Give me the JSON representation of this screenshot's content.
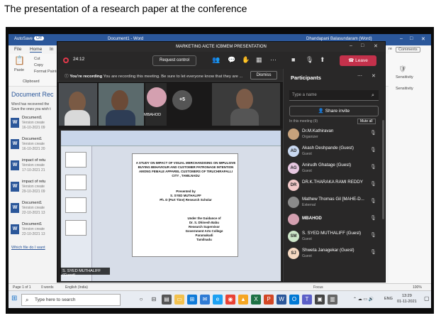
{
  "caption": "The presentation of a research paper at the conference",
  "word": {
    "autosave": "AutoSave",
    "autosave_state": "Off",
    "doc_title": "Document1 - Word",
    "user": "Dhandapani Balasundaram (Word)",
    "tabs": [
      "File",
      "Home",
      "In"
    ],
    "ribbon": {
      "paste": "Paste",
      "cut": "Cut",
      "copy": "Copy",
      "format_painter": "Format Painter",
      "clipboard": "Clipboard",
      "sensitivity": "Sensitivity",
      "comments": "Comments",
      "right_tab": "re"
    },
    "recovery": {
      "heading": "Document Rec",
      "line1": "Word has recovered the",
      "line2": "Save the ones you wish t",
      "items": [
        {
          "name": "Document1",
          "sub1": "Version create",
          "sub2": "16-10-2021 09"
        },
        {
          "name": "Document1",
          "sub1": "Version create",
          "sub2": "16-10-2021 20"
        },
        {
          "name": "impact of retu",
          "sub1": "Version create",
          "sub2": "17-10-2021 21"
        },
        {
          "name": "impact of retu",
          "sub1": "Version create",
          "sub2": "29-10-2021 09"
        },
        {
          "name": "Document1",
          "sub1": "Version create",
          "sub2": "22-10-2021 13"
        },
        {
          "name": "Document1",
          "sub1": "Version create",
          "sub2": "22-10-2021 13"
        }
      ],
      "link": "Which file do I want"
    },
    "status": {
      "page": "Page 1 of 1",
      "words": "0 words",
      "language": "English (India)",
      "focus": "Focus",
      "zoom": "100%"
    }
  },
  "teams": {
    "title": "MARKETING AICTE ICBMEM PRESENTATION",
    "timer": "24:12",
    "request_control": "Request control",
    "leave": "Leave",
    "banner_bold": "You're recording",
    "banner_text": "You are recording this meeting. Be sure to let everyone know that they are ...",
    "dismiss": "Dismiss",
    "tile_label": "MBAHOD",
    "more_count": "+5",
    "presenter_label": "S. SYED MUTHALIFF (Guest)",
    "slide": {
      "title": "A STUDY ON IMPACT OF VISUAL MERCHANDISING ON IMPULSIVE BUYING BEHAVIOUR AND CUSTOMER PATRONAGE INTENTION AMONG FEMALE APPAREL CUSTOMERS OF TIRUCHIRAPALLI CITY , TAMILNADU",
      "presented_by": "Presented by",
      "presenter": "S. SYED MUTHALIFF",
      "presenter_role": "Ph. D (Part Time) Research Scholar",
      "guidance": "Under the Guidance of",
      "guide": "Dr. S. Dhinesh Babu",
      "guide_role": "Research Supervisor",
      "college": "Government Arts College",
      "place": "Paramakudi",
      "state": "Tamilnadu"
    },
    "participants": {
      "heading": "Participants",
      "search_placeholder": "Type a name",
      "share_invite": "Share invite",
      "partial_text": "In this meeting (9)",
      "partial_btn": "Mute all",
      "list": [
        {
          "initials": "",
          "name": "Dr.M.Kathiravan",
          "role": "Organizer",
          "color": "#c7a27c"
        },
        {
          "initials": "AD",
          "name": "Akash Deshpande (Guest)",
          "role": "Guest",
          "color": "#c8d8f0"
        },
        {
          "initials": "AG",
          "name": "Anirudh Ghatage (Guest)",
          "role": "Guest",
          "color": "#e6c7e0"
        },
        {
          "initials": "DR",
          "name": "DR.K.THARAKA RAMI REDDY",
          "role": "",
          "color": "#f2c9c9"
        },
        {
          "initials": "",
          "name": "Mathew Thomas Gil [MAHE-D...",
          "role": "External",
          "color": "#8a8a8a"
        },
        {
          "initials": "",
          "name": "MBAHOD",
          "role": "",
          "color": "#d4a0b0"
        },
        {
          "initials": "SM",
          "name": "S. SYED MUTHALIFF (Guest)",
          "role": "Guest",
          "color": "#cde6c9"
        },
        {
          "initials": "SJ",
          "name": "Shweta Janagekar (Guest)",
          "role": "Guest",
          "color": "#f5d9c2"
        }
      ]
    }
  },
  "taskbar": {
    "search_placeholder": "Type here to search",
    "language": "ENG",
    "time": "13:29",
    "date": "01-11-2021"
  }
}
